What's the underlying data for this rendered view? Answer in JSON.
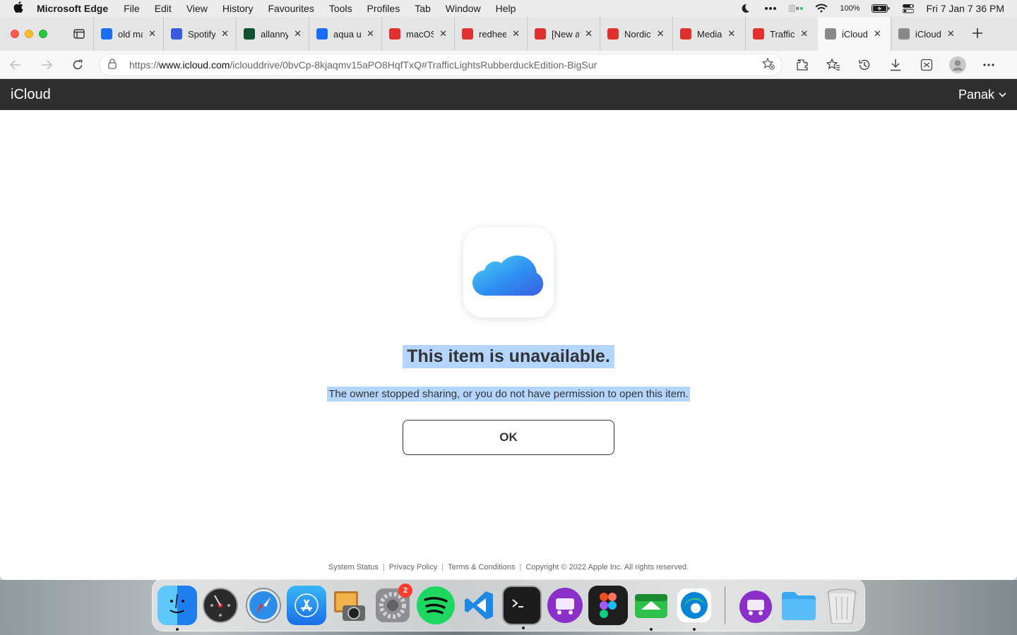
{
  "menubar": {
    "app_name": "Microsoft Edge",
    "items": [
      "File",
      "Edit",
      "View",
      "History",
      "Favourites",
      "Tools",
      "Profiles",
      "Tab",
      "Window",
      "Help"
    ],
    "battery": "100%",
    "datetime": "Fri 7 Jan  7 36 PM"
  },
  "tabs": [
    {
      "title": "old ma",
      "icon": "bing-icon",
      "color": "#1b6ef3"
    },
    {
      "title": "Spotify",
      "icon": "star-badge-icon",
      "color": "#3b5bdb"
    },
    {
      "title": "allanny",
      "icon": "z-icon",
      "color": "#0f5132"
    },
    {
      "title": "aqua u",
      "icon": "bing-icon",
      "color": "#1b6ef3"
    },
    {
      "title": "macOS",
      "icon": "shield-apple-icon",
      "color": "#e03131"
    },
    {
      "title": "redhee",
      "icon": "shield-apple-icon",
      "color": "#e03131"
    },
    {
      "title": "[New a",
      "icon": "shield-apple-icon",
      "color": "#e03131"
    },
    {
      "title": "Nordic",
      "icon": "shield-apple-icon",
      "color": "#e03131"
    },
    {
      "title": "Media",
      "icon": "shield-apple-icon",
      "color": "#e03131"
    },
    {
      "title": "Traffic",
      "icon": "shield-apple-icon",
      "color": "#e03131"
    },
    {
      "title": "iCloud",
      "icon": "apple-icon",
      "color": "#888888",
      "active": true
    },
    {
      "title": "iCloud",
      "icon": "apple-icon",
      "color": "#888888"
    }
  ],
  "address": {
    "scheme": "https://",
    "host": "www.icloud.com",
    "path": "/iclouddrive/0bvCp-8kjaqmv15aPO8HqfTxQ#TrafficLightsRubberduckEdition-BigSur"
  },
  "icloud": {
    "brand": "iCloud",
    "user": "Panak"
  },
  "message": {
    "heading": "This item is unavailable.",
    "body": "The owner stopped sharing, or you do not have permission to open this item.",
    "ok_label": "OK"
  },
  "footer": {
    "links": [
      "System Status",
      "Privacy Policy",
      "Terms & Conditions"
    ],
    "copyright": "Copyright © 2022 Apple Inc. All rights reserved."
  },
  "dock": {
    "settings_badge": "2"
  }
}
